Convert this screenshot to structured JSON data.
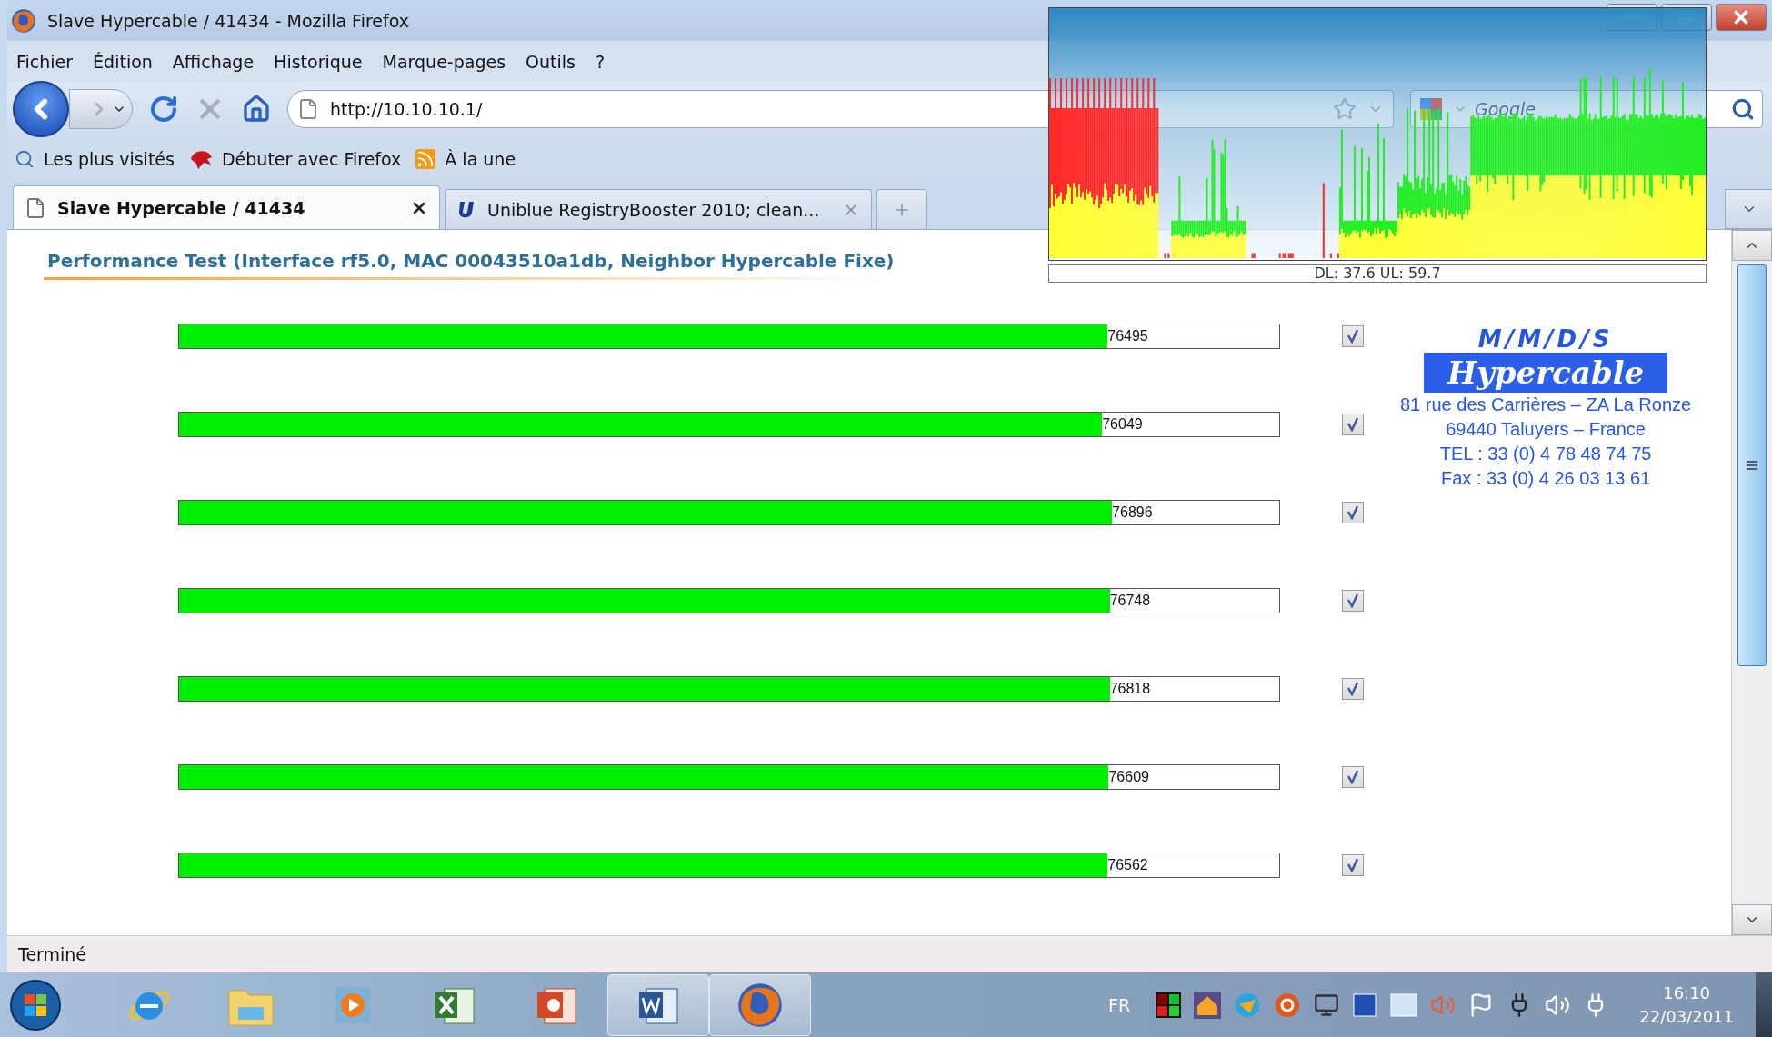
{
  "window": {
    "title": "Slave Hypercable / 41434 - Mozilla Firefox"
  },
  "menu": [
    {
      "label": "Fichier"
    },
    {
      "label": "Édition"
    },
    {
      "label": "Affichage"
    },
    {
      "label": "Historique"
    },
    {
      "label": "Marque-pages"
    },
    {
      "label": "Outils"
    },
    {
      "label": "?"
    }
  ],
  "address": {
    "value": "http://10.10.10.1/"
  },
  "search": {
    "placeholder": "Google"
  },
  "bookmarks": [
    {
      "label": "Les plus visités",
      "kind": "search"
    },
    {
      "label": "Débuter avec Firefox",
      "kind": "bug"
    },
    {
      "label": "À la une",
      "kind": "feed"
    }
  ],
  "tabs": [
    {
      "label": "Slave Hypercable / 41434",
      "selected": true,
      "kind": "page"
    },
    {
      "label": "Uniblue RegistryBooster 2010; clean...",
      "selected": false,
      "kind": "uniblue"
    }
  ],
  "page": {
    "heading": "Performance Test (Interface rf5.0, MAC 00043510a1db, Neighbor Hypercable Fixe)",
    "rows": [
      {
        "reading": "76495",
        "level": 0.844,
        "checked": true
      },
      {
        "reading": "76049",
        "level": 0.839,
        "checked": true
      },
      {
        "reading": "76896",
        "level": 0.848,
        "checked": true
      },
      {
        "reading": "76748",
        "level": 0.846,
        "checked": true
      },
      {
        "reading": "76818",
        "level": 0.846,
        "checked": true
      },
      {
        "reading": "76609",
        "level": 0.845,
        "checked": true
      },
      {
        "reading": "76562",
        "level": 0.844,
        "checked": true
      }
    ]
  },
  "stamp": {
    "brand": "M/M/D/S",
    "name": "Hypercable",
    "lines": [
      "81 rue des Carrières – ZA La Ronze",
      "69440 Taluyers – France",
      "TEL : 33 (0) 4 78 48 74 75",
      "Fax : 33 (0) 4 26 03 13 61"
    ]
  },
  "monitor": {
    "reading": "DL: 37.6 UL: 59.7"
  },
  "status_bar": {
    "text": "Terminé"
  },
  "taskbar": {
    "apps": [
      {
        "kind": "ie",
        "running": false
      },
      {
        "kind": "explorer",
        "running": false
      },
      {
        "kind": "media",
        "running": false
      },
      {
        "kind": "excel",
        "running": false
      },
      {
        "kind": "powerpoint",
        "running": false
      },
      {
        "kind": "word",
        "running": true
      },
      {
        "kind": "firefox",
        "running": true
      }
    ],
    "language": "FR",
    "time": "16:10",
    "date": "22/03/2011"
  }
}
